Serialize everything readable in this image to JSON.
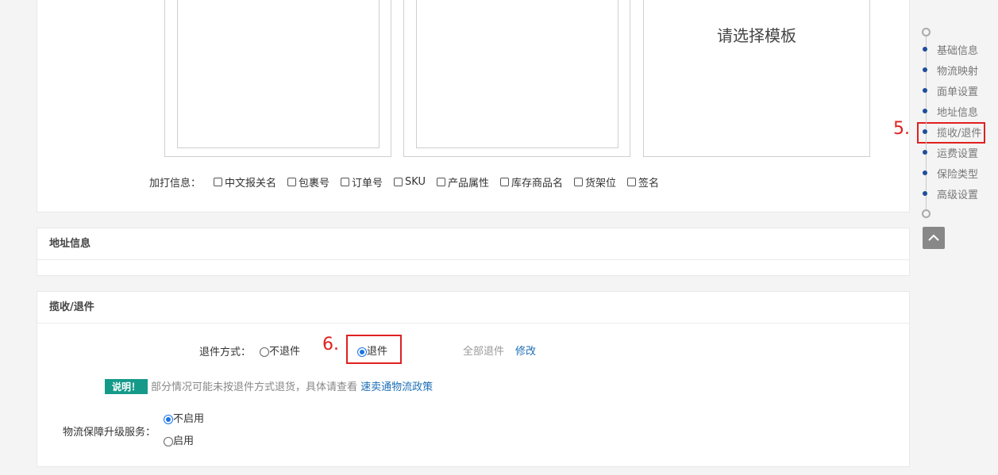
{
  "print_section": {
    "template_placeholder": "请选择模板",
    "extra_label": "加打信息：",
    "extra_options": [
      {
        "label": "中文报关名",
        "checked": false
      },
      {
        "label": "包裹号",
        "checked": false
      },
      {
        "label": "订单号",
        "checked": false
      },
      {
        "label": "SKU",
        "checked": false
      },
      {
        "label": "产品属性",
        "checked": false
      },
      {
        "label": "库存商品名",
        "checked": false
      },
      {
        "label": "货架位",
        "checked": false
      },
      {
        "label": "签名",
        "checked": false
      }
    ]
  },
  "address_section": {
    "title": "地址信息"
  },
  "return_section": {
    "title": "揽收/退件",
    "method_label": "退件方式：",
    "option_no_return": "不退件",
    "option_return": "退件",
    "selected": "退件",
    "current_value": "全部退件",
    "modify_link": "修改",
    "note_tag": "说明！",
    "note_text": "部分情况可能未按退件方式退货，具体请查看",
    "note_link": "速卖通物流政策",
    "upgrade_label": "物流保障升级服务：",
    "upgrade_options": [
      {
        "label": "不启用",
        "selected": true
      },
      {
        "label": "启用",
        "selected": false
      }
    ]
  },
  "annotations": {
    "step5": "5.",
    "step6": "6."
  },
  "side_nav": {
    "items": [
      "基础信息",
      "物流映射",
      "面单设置",
      "地址信息",
      "揽收/退件",
      "运费设置",
      "保险类型",
      "高级设置"
    ],
    "active": "揽收/退件"
  },
  "colors": {
    "accent": "#1a73e8",
    "annotation": "#e02020",
    "note_tag": "#159a8a",
    "link": "#1e6fb8"
  }
}
